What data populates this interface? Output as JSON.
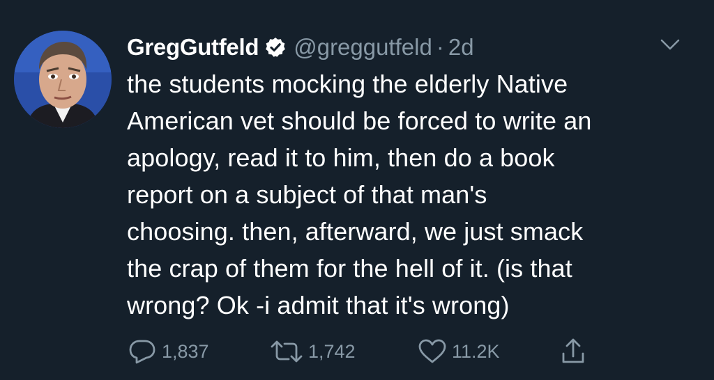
{
  "tweet": {
    "author_name": "GregGutfeld",
    "handle": "@greggutfeld",
    "separator": "·",
    "time": "2d",
    "text_lines": [
      "the students mocking the elderly Native",
      "American vet should be forced to write an",
      "apology, read it to him, then do a book",
      "report on a subject of that man's",
      "choosing. then, afterward, we just smack",
      "the crap of them for the hell of it. (is that",
      "wrong? Ok -i admit that it's wrong)"
    ],
    "replies": "1,837",
    "retweets": "1,742",
    "likes": "11.2K"
  },
  "icons": {
    "verified": "verified-badge-icon",
    "menu": "chevron-down-icon",
    "reply": "reply-icon",
    "retweet": "retweet-icon",
    "like": "heart-icon",
    "share": "share-icon"
  },
  "colors": {
    "background": "#15202b",
    "text": "#ffffff",
    "secondary": "#8899a6",
    "avatar_bg": "#1d3f8c"
  }
}
